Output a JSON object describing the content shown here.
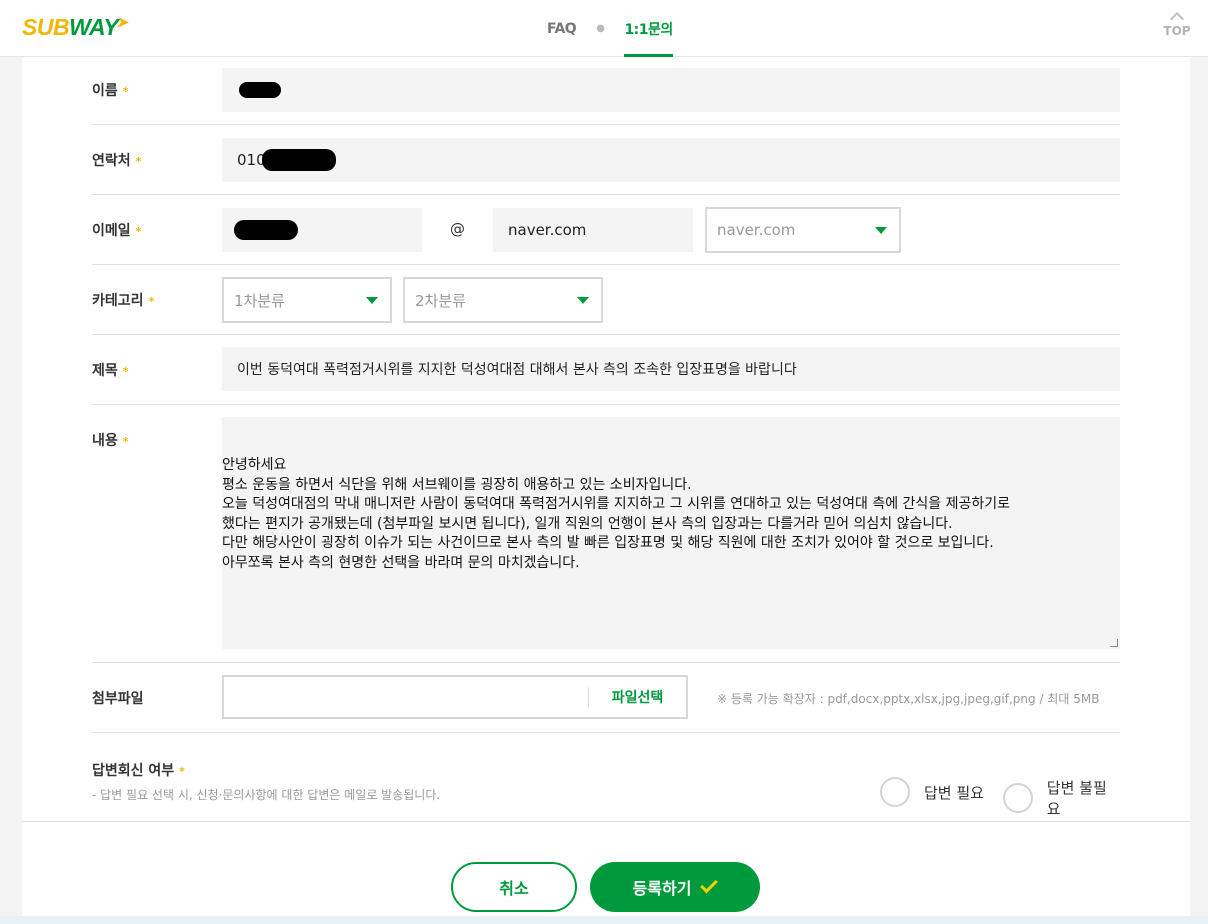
{
  "header": {
    "logo_sub": "SUB",
    "logo_way": "WAY",
    "tabs": [
      {
        "label": "FAQ",
        "active": false
      },
      {
        "label": "1:1문의",
        "active": true
      }
    ],
    "top_label": "TOP"
  },
  "form": {
    "required_mark": "*",
    "name": {
      "label": "이름",
      "value": ""
    },
    "contact": {
      "label": "연락처",
      "value": "010"
    },
    "email": {
      "label": "이메일",
      "local": "",
      "at": "@",
      "domain": "naver.com",
      "domain_select": "naver.com"
    },
    "category": {
      "label": "카테고리",
      "first": "1차분류",
      "second": "2차분류"
    },
    "subject": {
      "label": "제목",
      "value": "이번 동덕여대 폭력점거시위를 지지한 덕성여대점 대해서 본사 측의 조속한 입장표명을 바랍니다"
    },
    "content": {
      "label": "내용",
      "value": "안녕하세요\n평소 운동을 하면서 식단을 위해 서브웨이를 굉장히 애용하고 있는 소비자입니다.\n오늘 덕성여대점의 막내 매니저란 사람이 동덕여대 폭력점거시위를 지지하고 그 시위를 연대하고 있는 덕성여대 측에 간식을 제공하기로\n했다는 편지가 공개됐는데 (첨부파일 보시면 됩니다), 일개 직원의 언행이 본사 측의 입장과는 다를거라 믿어 의심치 않습니다.\n다만 해당사안이 굉장히 이슈가 되는 사건이므로 본사 측의 발 빠른 입장표명 및 해당 직원에 대한 조치가 있어야 할 것으로 보입니다.\n아무쪼록 본사 측의 현명한 선택을 바라며 문의 마치겠습니다."
    },
    "attachment": {
      "label": "첨부파일",
      "button": "파일선택",
      "note": "※ 등록 가능 확장자 : pdf,docx,pptx,xlsx,jpg,jpeg,gif,png / 최대 5MB"
    },
    "reply": {
      "label": "답변회신 여부",
      "hint": "- 답변 필요 선택 시, 신청·문의사항에 대한 답변은 메일로 발송됩니다.",
      "options": [
        "답변 필요",
        "답변 불필요"
      ]
    }
  },
  "actions": {
    "cancel": "취소",
    "submit": "등록하기"
  },
  "colors": {
    "brand_green": "#009a3e",
    "brand_yellow": "#f2b705"
  }
}
